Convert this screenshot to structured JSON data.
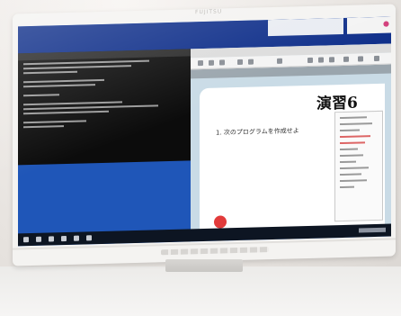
{
  "monitor": {
    "brand": "FUJITSU"
  },
  "slide": {
    "title": "演習6",
    "bullet": "1. 次のプログラムを作成せよ"
  },
  "colors": {
    "desktop": "#1f56b8",
    "console": "#0c0c0c",
    "slide_bg": "#ffffff",
    "record_button": "#e23b3b"
  }
}
